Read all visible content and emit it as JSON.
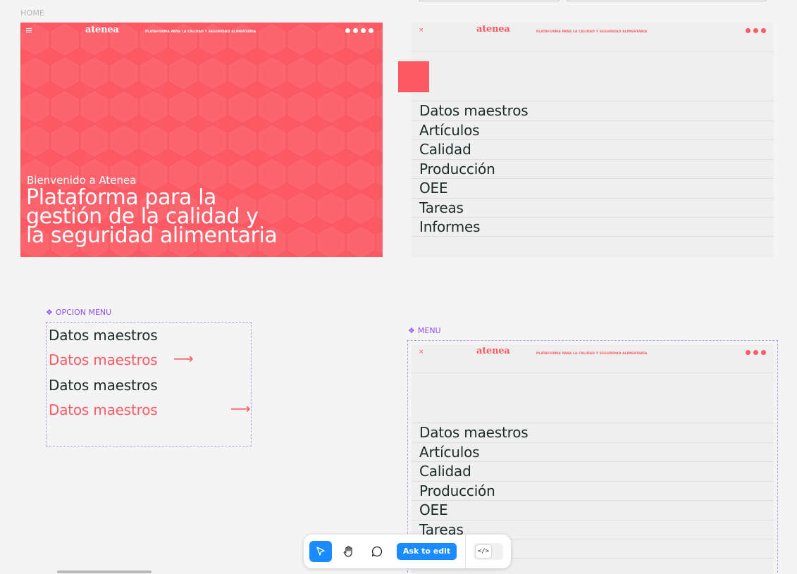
{
  "frames": {
    "home_label": "HOME",
    "opcion_menu_label": "OPCION MENU",
    "menu_label": "MENU"
  },
  "header": {
    "brand": "atenea",
    "tagline": "PLATAFORMA PARA LA CALIDAD Y SEGURIDAD ALIMENTARIA",
    "close_glyph": "×"
  },
  "hero": {
    "welcome": "Bienvenido a Atenea",
    "title_lines": [
      "Plataforma para la",
      "gestión de la calidad y",
      "la seguridad alimentaria"
    ]
  },
  "menu": {
    "items": [
      "Datos maestros",
      "Artículos",
      "Calidad",
      "Producción",
      "OEE",
      "Tareas",
      "Informes"
    ]
  },
  "opcion_menu": {
    "variants": [
      {
        "label": "Datos maestros",
        "state": "default"
      },
      {
        "label": "Datos maestros",
        "state": "hover"
      },
      {
        "label": "Datos maestros",
        "state": "default"
      },
      {
        "label": "Datos maestros",
        "state": "hover"
      }
    ],
    "arrow_glyph": "⟶"
  },
  "toolbar": {
    "ask_label": "Ask to edit",
    "code_glyph": "</>"
  },
  "colors": {
    "accent": "#fc5a64",
    "text": "#1d2b2b",
    "component": "#8e4ff0",
    "primary_button": "#1a8cff"
  }
}
